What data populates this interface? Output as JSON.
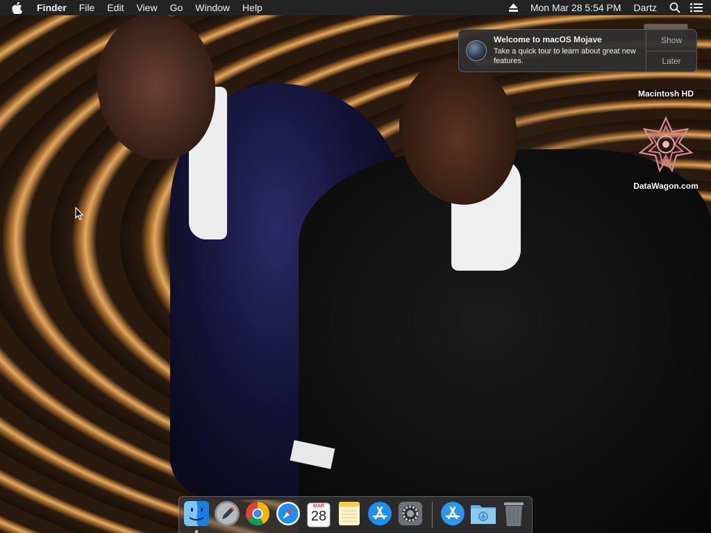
{
  "menubar": {
    "app_name": "Finder",
    "menus": [
      "File",
      "Edit",
      "View",
      "Go",
      "Window",
      "Help"
    ],
    "clock": "Mon Mar 28  5:54 PM",
    "user": "Dartz"
  },
  "notification": {
    "title": "Welcome to macOS Mojave",
    "body": "Take a quick tour to learn about great new features.",
    "actions": [
      "Show",
      "Later"
    ]
  },
  "desktop_icons": [
    {
      "label": "Macintosh HD",
      "icon": "hard-drive-icon"
    },
    {
      "label": "DataWagon.com",
      "icon": "datawagon-logo-icon"
    }
  ],
  "calendar": {
    "month": "MAR",
    "day": "28"
  },
  "dock": {
    "items": [
      {
        "name": "finder",
        "icon": "finder-icon",
        "running": true
      },
      {
        "name": "launchpad",
        "icon": "launchpad-icon"
      },
      {
        "name": "chrome",
        "icon": "chrome-icon"
      },
      {
        "name": "safari",
        "icon": "safari-icon"
      },
      {
        "name": "calendar",
        "icon": "calendar-icon"
      },
      {
        "name": "notes",
        "icon": "notes-icon"
      },
      {
        "name": "app-store",
        "icon": "app-store-icon"
      },
      {
        "name": "system-preferences",
        "icon": "gear-icon"
      },
      {
        "name": "applications-stack",
        "icon": "app-store-icon"
      },
      {
        "name": "downloads-stack",
        "icon": "folder-icon"
      },
      {
        "name": "trash",
        "icon": "trash-icon"
      }
    ]
  },
  "colors": {
    "menubar_bg": "#232323",
    "notification_bg": "#303030",
    "accent_blue": "#1d8ff2"
  }
}
